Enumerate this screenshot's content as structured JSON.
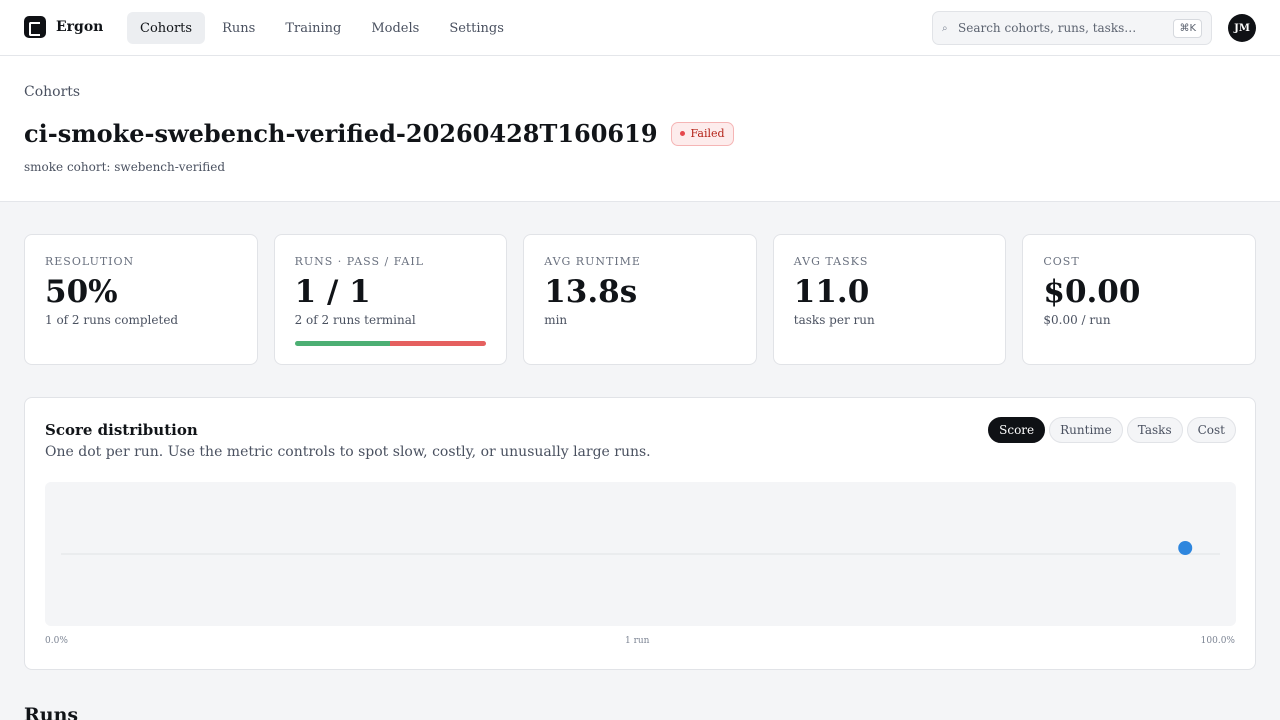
{
  "app": {
    "name": "Ergon"
  },
  "nav": {
    "items": [
      {
        "label": "Cohorts",
        "active": true
      },
      {
        "label": "Runs",
        "active": false
      },
      {
        "label": "Training",
        "active": false
      },
      {
        "label": "Models",
        "active": false
      },
      {
        "label": "Settings",
        "active": false
      }
    ]
  },
  "search": {
    "placeholder": "Search cohorts, runs, tasks…",
    "shortcut": "⌘K",
    "icon": "search-icon"
  },
  "user": {
    "initials": "JM"
  },
  "breadcrumb": "Cohorts",
  "cohort": {
    "title": "ci-smoke-swebench-verified-20260428T160619",
    "status": "Failed",
    "status_color": "#e5484d",
    "subtitle": "smoke cohort: swebench-verified"
  },
  "stats": {
    "resolution": {
      "label": "RESOLUTION",
      "value": "50%",
      "sub": "1 of 2 runs completed"
    },
    "runs": {
      "label": "RUNS · PASS / FAIL",
      "value": "1 / 1",
      "sub": "2 of 2 runs terminal",
      "pass": 1,
      "fail": 1,
      "pass_color": "#4caf73",
      "fail_color": "#e5605f"
    },
    "runtime": {
      "label": "AVG RUNTIME",
      "value": "13.8s",
      "sub": "min"
    },
    "tasks": {
      "label": "AVG TASKS",
      "value": "11.0",
      "sub": "tasks per run"
    },
    "cost": {
      "label": "COST",
      "value": "$0.00",
      "sub": "$0.00 / run"
    }
  },
  "distribution": {
    "title": "Score distribution",
    "description": "One dot per run. Use the metric controls to spot slow, costly, or unusually large runs.",
    "metrics": [
      {
        "label": "Score",
        "active": true
      },
      {
        "label": "Runtime",
        "active": false
      },
      {
        "label": "Tasks",
        "active": false
      },
      {
        "label": "Cost",
        "active": false
      }
    ],
    "axis_min_label": "0.0%",
    "axis_mid_label": "1 run",
    "axis_max_label": "100.0%",
    "dot_color": "#2e86de"
  },
  "chart_data": {
    "type": "scatter",
    "x_range": [
      0,
      100
    ],
    "points": [
      {
        "x": 97
      }
    ]
  },
  "runs_section": {
    "title": "Runs"
  }
}
